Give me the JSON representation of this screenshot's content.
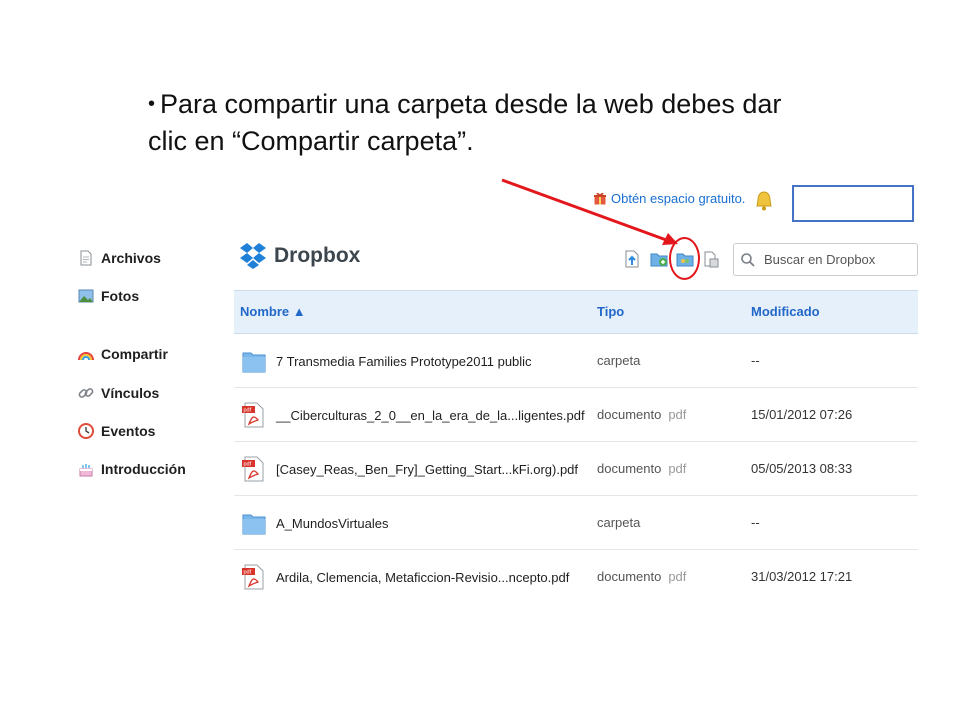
{
  "slide": {
    "bullet": "•",
    "line1": "Para compartir una carpeta desde la web debes dar",
    "line2": "clic en “Compartir carpeta”."
  },
  "header": {
    "promo": "Obtén espacio gratuito.",
    "logo": "Dropbox",
    "search_placeholder": "Buscar en Dropbox"
  },
  "sidebar": {
    "items": [
      {
        "label": "Archivos",
        "icon": "document-icon"
      },
      {
        "label": "Fotos",
        "icon": "photo-icon"
      },
      {
        "label": "Compartir",
        "icon": "rainbow-icon"
      },
      {
        "label": "Vínculos",
        "icon": "link-icon"
      },
      {
        "label": "Eventos",
        "icon": "clock-icon"
      },
      {
        "label": "Introducción",
        "icon": "cake-icon"
      }
    ]
  },
  "table": {
    "columns": {
      "name": "Nombre ▲",
      "type": "Tipo",
      "modified": "Modificado"
    },
    "rows": [
      {
        "name": "7 Transmedia Families Prototype2011 public",
        "type": "carpeta",
        "ext": "",
        "date": "--",
        "icon": "folder-icon"
      },
      {
        "name": "__Ciberculturas_2_0__en_la_era_de_la...ligentes.pdf",
        "type": "documento",
        "ext": "pdf",
        "date": "15/01/2012 07:26",
        "icon": "pdf-icon"
      },
      {
        "name": "[Casey_Reas,_Ben_Fry]_Getting_Start...kFi.org).pdf",
        "type": "documento",
        "ext": "pdf",
        "date": "05/05/2013 08:33",
        "icon": "pdf-icon"
      },
      {
        "name": "A_MundosVirtuales",
        "type": "carpeta",
        "ext": "",
        "date": "--",
        "icon": "folder-icon"
      },
      {
        "name": "Ardila, Clemencia, Metaficcion-Revisio...ncepto.pdf",
        "type": "documento",
        "ext": "pdf",
        "date": "31/03/2012 17:21",
        "icon": "pdf-icon"
      }
    ]
  },
  "colors": {
    "accent": "#2168c8",
    "annotation": "#e3161b",
    "header_bg": "#e6f0fa"
  }
}
